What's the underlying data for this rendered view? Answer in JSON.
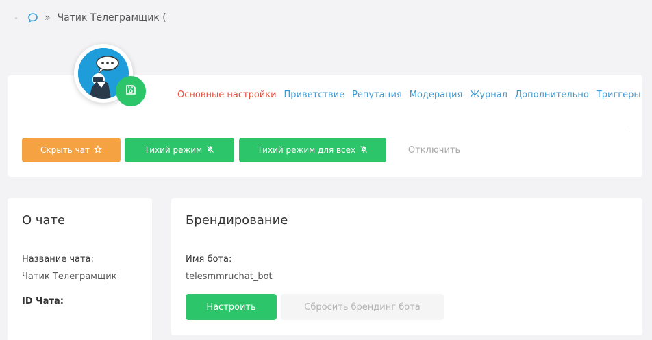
{
  "breadcrumb": {
    "chat_icon": "chat-bubble-icon",
    "separator": "»",
    "title": "Чатик Телеграмщик ("
  },
  "profile": {
    "avatar_icon": "telegram-bot-avatar",
    "save_icon": "floppy-disk-icon"
  },
  "tabs": [
    {
      "label": "Основные настройки",
      "active": true
    },
    {
      "label": "Приветствие",
      "active": false
    },
    {
      "label": "Репутация",
      "active": false
    },
    {
      "label": "Модерация",
      "active": false
    },
    {
      "label": "Журнал",
      "active": false
    },
    {
      "label": "Дополнительно",
      "active": false
    },
    {
      "label": "Триггеры",
      "active": false
    }
  ],
  "actions": {
    "hide_chat": "Скрыть чат",
    "hide_chat_icon": "star-icon",
    "silent_mode": "Тихий режим",
    "silent_mode_icon": "bell-off-icon",
    "silent_all": "Тихий режим для всех",
    "silent_all_icon": "bell-off-icon",
    "disable": "Отключить"
  },
  "about": {
    "title": "О чате",
    "name_label": "Название чата:",
    "name_value": "Чатик Телеграмщик",
    "id_label": "ID Чата:"
  },
  "branding": {
    "title": "Брендирование",
    "bot_name_label": "Имя бота:",
    "bot_name_value": "telesmmruchat_bot",
    "setup_button": "Настроить",
    "reset_button": "Сбросить брендинг бота"
  },
  "colors": {
    "accent_green": "#2dc56a",
    "accent_orange": "#f5a243",
    "tab_link": "#3d9ad1",
    "tab_active": "#e74c3c"
  }
}
